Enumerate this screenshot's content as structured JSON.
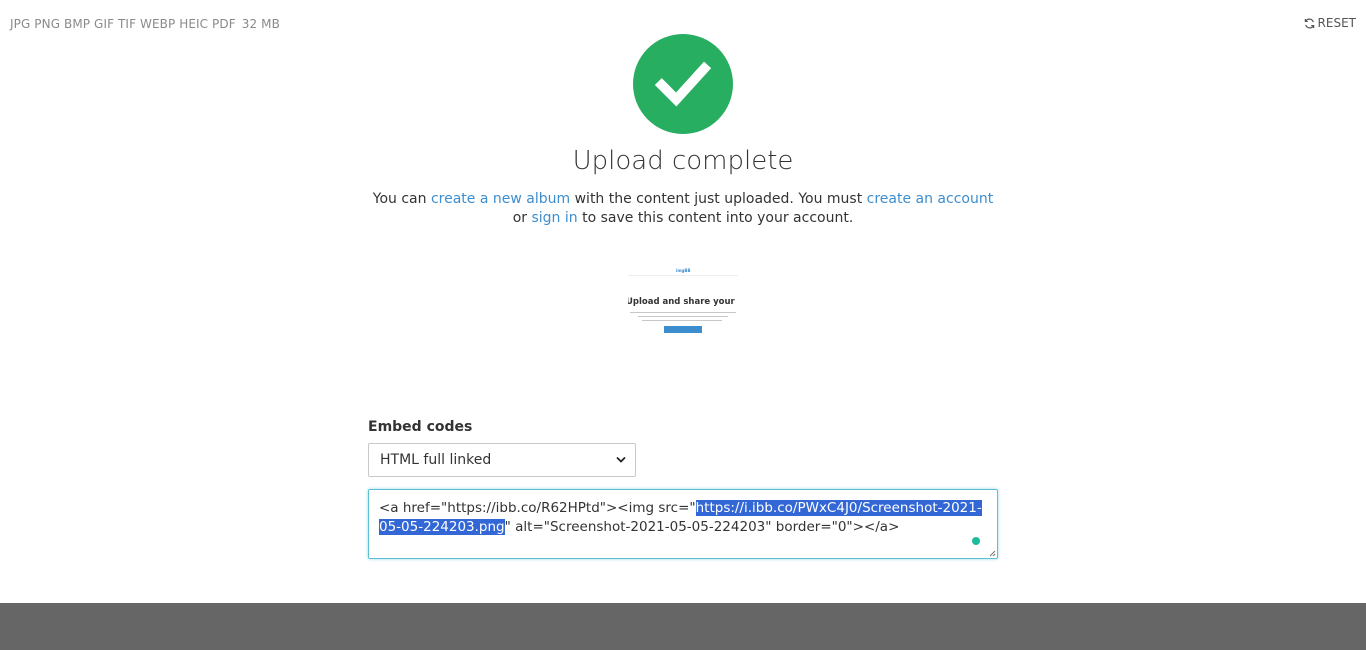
{
  "header": {
    "formats": "JPG PNG BMP GIF TIF WEBP HEIC PDF",
    "max_size": "32 MB",
    "reset_label": "RESET"
  },
  "status": {
    "title": "Upload complete",
    "icon": "check-circle-icon",
    "accent_color": "#27ae60"
  },
  "message": {
    "part1": "You can ",
    "link_album": "create a new album",
    "part2": " with the content just uploaded. You must ",
    "link_account": "create an account",
    "part3": " or ",
    "link_signin": "sign in",
    "part4": " to save this content into your account."
  },
  "thumbnail": {
    "heading": "Upload and share your images.",
    "logo": "imgBB"
  },
  "embed": {
    "label": "Embed codes",
    "selected_option": "HTML full linked",
    "code_prefix": "<a href=\"https://ibb.co/R62HPtd\"><img src=\"",
    "code_selected": "https://i.ibb.co/PWxC4J0/Screenshot-2021-05-05-224203.png",
    "code_suffix": "\" alt=\"Screenshot-2021-05-05-224203\" border=\"0\"></a>"
  },
  "colors": {
    "link": "#3d8ecf",
    "footer": "#666666",
    "selection": "#3367d6"
  }
}
